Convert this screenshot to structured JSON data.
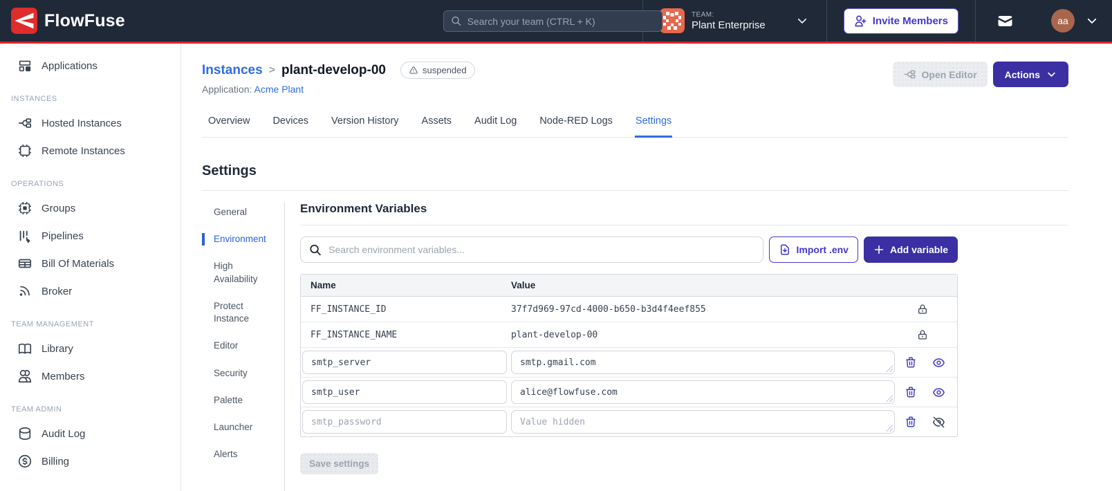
{
  "colors": {
    "navbar_bg": "#1f2937",
    "brand_red": "#d92329",
    "indigo_button": "#3b2fa3",
    "indigo_text": "#4338ca",
    "link_blue": "#2e6ce4"
  },
  "navbar": {
    "brand": "FlowFuse",
    "search_placeholder": "Search your team (CTRL + K)",
    "team_label": "TEAM:",
    "team_name": "Plant Enterprise",
    "invite_button": "Invite Members",
    "avatar_initials": "aa"
  },
  "sidebar": {
    "sections": [
      {
        "label": "",
        "items": [
          {
            "label": "Applications",
            "icon": "applications-icon"
          }
        ]
      },
      {
        "label": "INSTANCES",
        "items": [
          {
            "label": "Hosted Instances",
            "icon": "hosted-instances-icon"
          },
          {
            "label": "Remote Instances",
            "icon": "remote-instances-icon"
          }
        ]
      },
      {
        "label": "OPERATIONS",
        "items": [
          {
            "label": "Groups",
            "icon": "groups-icon"
          },
          {
            "label": "Pipelines",
            "icon": "pipelines-icon"
          },
          {
            "label": "Bill Of Materials",
            "icon": "bill-of-materials-icon"
          },
          {
            "label": "Broker",
            "icon": "broker-icon"
          }
        ]
      },
      {
        "label": "TEAM MANAGEMENT",
        "items": [
          {
            "label": "Library",
            "icon": "library-icon"
          },
          {
            "label": "Members",
            "icon": "members-icon"
          }
        ]
      },
      {
        "label": "TEAM ADMIN",
        "items": [
          {
            "label": "Audit Log",
            "icon": "audit-log-icon"
          },
          {
            "label": "Billing",
            "icon": "billing-icon"
          }
        ]
      }
    ]
  },
  "header": {
    "breadcrumb_parent": "Instances",
    "breadcrumb_separator": ">",
    "breadcrumb_current": "plant-develop-00",
    "status_badge": "suspended",
    "application_label": "Application:",
    "application_name": "Acme Plant",
    "open_editor_button": "Open Editor",
    "actions_button": "Actions"
  },
  "tabs": [
    {
      "label": "Overview"
    },
    {
      "label": "Devices"
    },
    {
      "label": "Version History"
    },
    {
      "label": "Assets"
    },
    {
      "label": "Audit Log"
    },
    {
      "label": "Node-RED Logs"
    },
    {
      "label": "Settings",
      "active": true
    }
  ],
  "settings": {
    "title": "Settings",
    "subnav": [
      {
        "label": "General"
      },
      {
        "label": "Environment",
        "active": true
      },
      {
        "label": "High Availability"
      },
      {
        "label": "Protect Instance"
      },
      {
        "label": "Editor"
      },
      {
        "label": "Security"
      },
      {
        "label": "Palette"
      },
      {
        "label": "Launcher"
      },
      {
        "label": "Alerts"
      }
    ],
    "panel": {
      "title": "Environment Variables",
      "search_placeholder": "Search environment variables...",
      "import_button": "Import .env",
      "add_button": "Add variable",
      "table": {
        "columns": {
          "name": "Name",
          "value": "Value"
        },
        "rows": [
          {
            "name": "FF_INSTANCE_ID",
            "value": "37f7d969-97cd-4000-b650-b3d4f4eef855",
            "locked": true
          },
          {
            "name": "FF_INSTANCE_NAME",
            "value": "plant-develop-00",
            "locked": true
          },
          {
            "name": "smtp_server",
            "value": "smtp.gmail.com",
            "locked": false,
            "hidden": false
          },
          {
            "name": "smtp_user",
            "value": "alice@flowfuse.com",
            "locked": false,
            "hidden": false
          },
          {
            "name": "smtp_password",
            "value_placeholder": "Value hidden",
            "locked": false,
            "hidden": true
          }
        ]
      },
      "save_button": "Save settings"
    }
  }
}
